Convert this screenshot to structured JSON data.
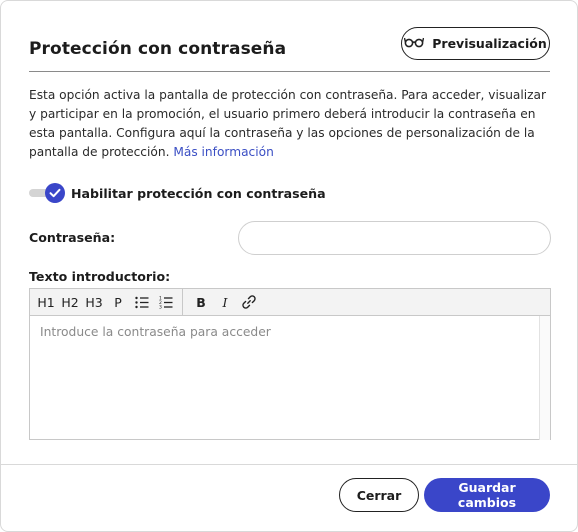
{
  "header": {
    "title": "Protección con contraseña",
    "preview_label": "Previsualización",
    "preview_icon": "glasses-icon"
  },
  "description": {
    "text": "Esta opción activa la pantalla de protección con contraseña. Para acceder, visualizar y participar en la promoción, el usuario primero deberá introducir la contraseña en esta pantalla. Configura aquí la contraseña y las opciones de personalización de la pantalla de protección.",
    "link": "Más información"
  },
  "toggle": {
    "label": "Habilitar protección con contraseña",
    "enabled": true
  },
  "password": {
    "label": "Contraseña:",
    "value": ""
  },
  "intro": {
    "label": "Texto introductorio:",
    "placeholder": "Introduce la contraseña para acceder",
    "toolbar": [
      "H1",
      "H2",
      "H3",
      "P",
      "bullet-list-icon",
      "numbered-list-icon",
      "B",
      "I",
      "link-icon"
    ]
  },
  "footer": {
    "close_label": "Cerrar",
    "save_label": "Guardar cambios"
  },
  "colors": {
    "accent": "#3a46c9",
    "link": "#3b4fc4"
  }
}
